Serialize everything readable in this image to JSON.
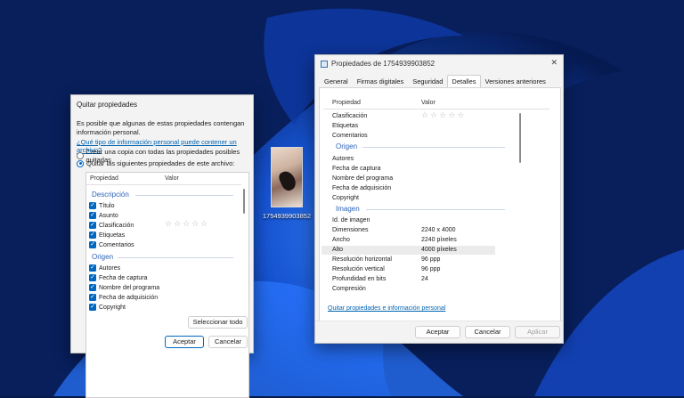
{
  "desktop": {
    "icon_label": "1754939903852"
  },
  "remove_dialog": {
    "title": "Quitar propiedades",
    "intro": "Es posible que algunas de estas propiedades contengan información personal.",
    "link": "¿Qué tipo de información personal puede contener un archivo?",
    "radio_copy": "Crear una copia con todas las propiedades posibles quitadas",
    "radio_remove": "Quitar las siguientes propiedades de este archivo:",
    "col_property": "Propiedad",
    "col_value": "Valor",
    "group_description": "Descripción",
    "description_items": [
      "Título",
      "Asunto",
      "Clasificación",
      "Etiquetas",
      "Comentarios"
    ],
    "group_origin": "Origen",
    "origin_items": [
      "Autores",
      "Fecha de captura",
      "Nombre del programa",
      "Fecha de adquisición",
      "Copyright"
    ],
    "stars": "☆☆☆☆☆",
    "select_all": "Seleccionar todo",
    "accept": "Aceptar",
    "cancel": "Cancelar"
  },
  "props_dialog": {
    "title": "Propiedades de 1754939903852",
    "close_glyph": "✕",
    "tabs": [
      "General",
      "Firmas digitales",
      "Seguridad",
      "Detalles",
      "Versiones anteriores"
    ],
    "active_tab": "Detalles",
    "col_property": "Propiedad",
    "col_value": "Valor",
    "rows_top": [
      "Clasificación",
      "Etiquetas",
      "Comentarios"
    ],
    "stars": "☆☆☆☆☆",
    "group_origin": "Origen",
    "origin_rows": [
      "Autores",
      "Fecha de captura",
      "Nombre del programa",
      "Fecha de adquisición",
      "Copyright"
    ],
    "group_image": "Imagen",
    "image_rows": [
      {
        "label": "Id. de imagen",
        "value": ""
      },
      {
        "label": "Dimensiones",
        "value": "2240 x 4000"
      },
      {
        "label": "Ancho",
        "value": "2240 píxeles"
      },
      {
        "label": "Alto",
        "value": "4000 píxeles"
      },
      {
        "label": "Resolución horizontal",
        "value": "96 ppp"
      },
      {
        "label": "Resolución vertical",
        "value": "96 ppp"
      },
      {
        "label": "Profundidad en bits",
        "value": "24"
      },
      {
        "label": "Compresión",
        "value": ""
      }
    ],
    "link": "Quitar propiedades e información personal",
    "accept": "Aceptar",
    "cancel": "Cancelar",
    "apply": "Aplicar"
  }
}
